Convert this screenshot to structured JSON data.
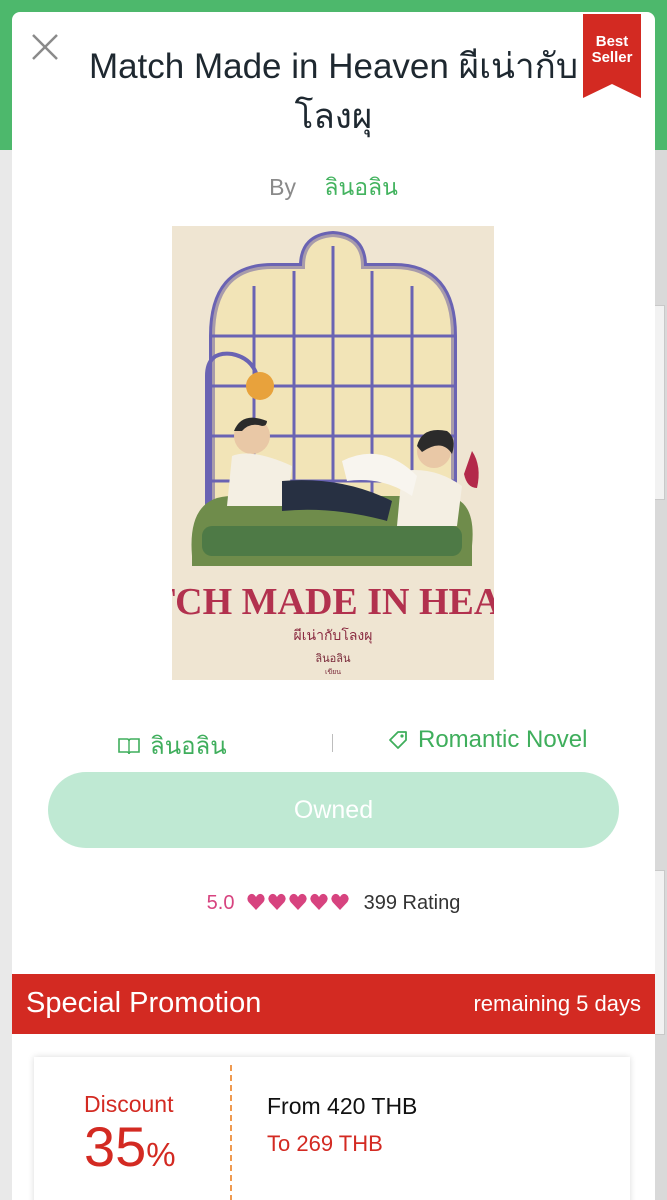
{
  "book": {
    "title": "Match Made in Heaven ผีเน่ากับโลงผุ",
    "by_label": "By",
    "author": "ลินอลิน",
    "cover_title": "MATCH MADE IN HEAVEN",
    "cover_subtitle": "ผีเน่ากับโลงผุ",
    "cover_author": "ลินอลิน",
    "cover_author_sub": "เขียน"
  },
  "badge": {
    "line1": "Best",
    "line2": "Seller",
    "color": "#d32a22"
  },
  "meta": {
    "publisher": "ลินอลิน",
    "publisher_icon": "book-open-icon",
    "category": "Romantic Novel",
    "category_icon": "tag-icon"
  },
  "action": {
    "owned_label": "Owned"
  },
  "rating": {
    "score": "5.0",
    "hearts": 5,
    "count_label": "399 Rating",
    "heart_color": "#d7437f"
  },
  "promotion": {
    "label": "Special Promotion",
    "remaining": "remaining 5 days",
    "discount_label": "Discount",
    "discount_value": "35",
    "discount_unit": "%",
    "from_price": "From 420 THB",
    "to_price": "To 269 THB"
  },
  "colors": {
    "brand_green": "#43b35f",
    "promo_red": "#d32a22",
    "owned_bg": "#bfe9d3"
  }
}
